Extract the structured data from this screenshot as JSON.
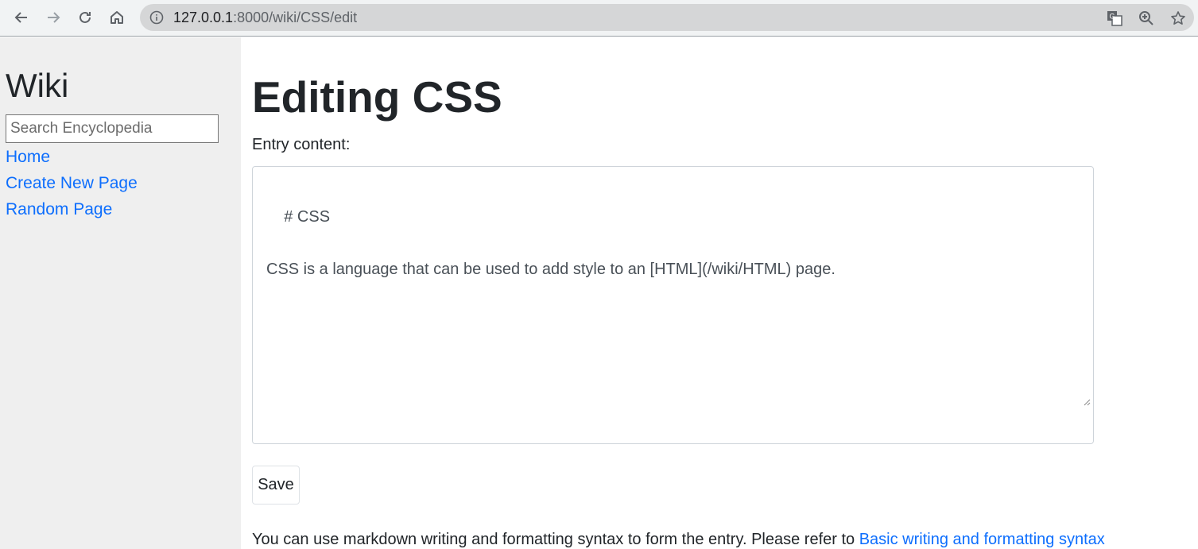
{
  "browser": {
    "url_host": "127.0.0.1",
    "url_path": ":8000/wiki/CSS/edit",
    "icons": [
      "back-arrow-icon",
      "forward-arrow-icon",
      "reload-icon",
      "home-icon",
      "info-icon",
      "translate-icon",
      "zoom-icon",
      "bookmark-star-icon"
    ]
  },
  "sidebar": {
    "title": "Wiki",
    "search_placeholder": "Search Encyclopedia",
    "links": [
      {
        "label": "Home"
      },
      {
        "label": "Create New Page"
      },
      {
        "label": "Random Page"
      }
    ]
  },
  "main": {
    "title": "Editing CSS",
    "content_label": "Entry content:",
    "content_value": "# CSS\n\nCSS is a language that can be used to add style to an [HTML](/wiki/HTML) page.",
    "save_label": "Save",
    "help_text": "You can use markdown writing and formatting syntax to form the entry. Please refer to ",
    "help_link": "Basic writing and formatting syntax"
  },
  "colors": {
    "link": "#0d6efd",
    "sidebar_bg": "#efefef",
    "chrome_bg": "#f1f3f4"
  }
}
